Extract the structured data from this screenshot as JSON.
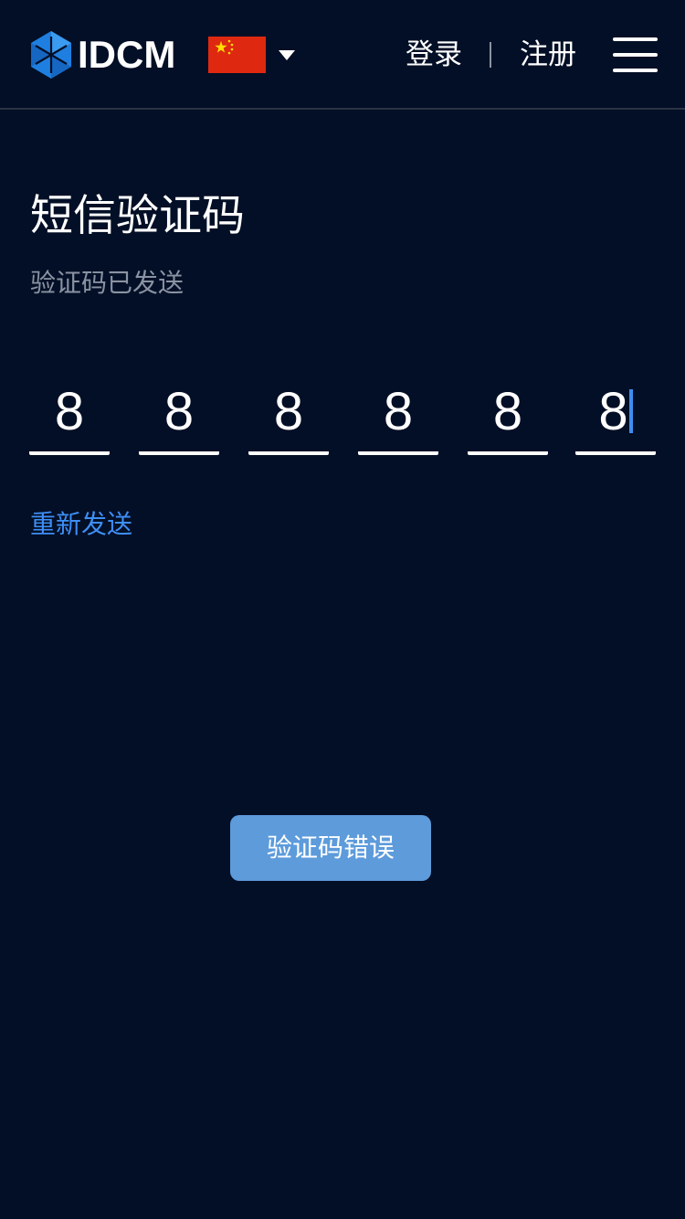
{
  "header": {
    "brand": "IDCM",
    "region_flag": "china-flag-icon",
    "login_label": "登录",
    "register_label": "注册"
  },
  "main": {
    "title": "短信验证码",
    "subtitle": "验证码已发送",
    "code_digits": [
      "8",
      "8",
      "8",
      "8",
      "8",
      "8"
    ],
    "resend_label": "重新发送"
  },
  "toast": {
    "message": "验证码错误"
  },
  "colors": {
    "background": "#030f26",
    "accent": "#3e8ef5",
    "toast_bg": "#5d9bdb",
    "muted_text": "#8a93a3"
  }
}
